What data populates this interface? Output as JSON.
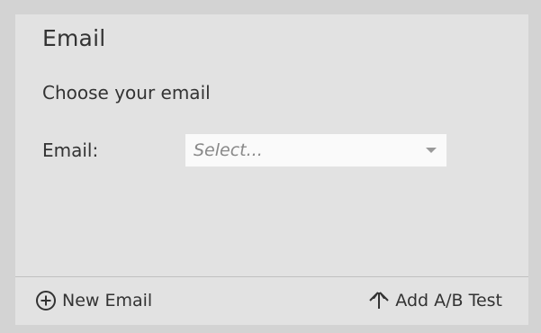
{
  "panel": {
    "title": "Email",
    "subtitle": "Choose your email"
  },
  "email_field": {
    "label": "Email:",
    "placeholder": "Select..."
  },
  "footer": {
    "new_email_label": "New Email",
    "new_email_icon": "plus-circle-icon",
    "ab_test_label": "Add A/B Test",
    "ab_test_icon": "split-arrows-icon"
  },
  "colors": {
    "background": "#d3d3d3",
    "panel": "#e2e2e2",
    "select_bg": "#fafafa",
    "text": "#333333",
    "placeholder": "#888888"
  }
}
